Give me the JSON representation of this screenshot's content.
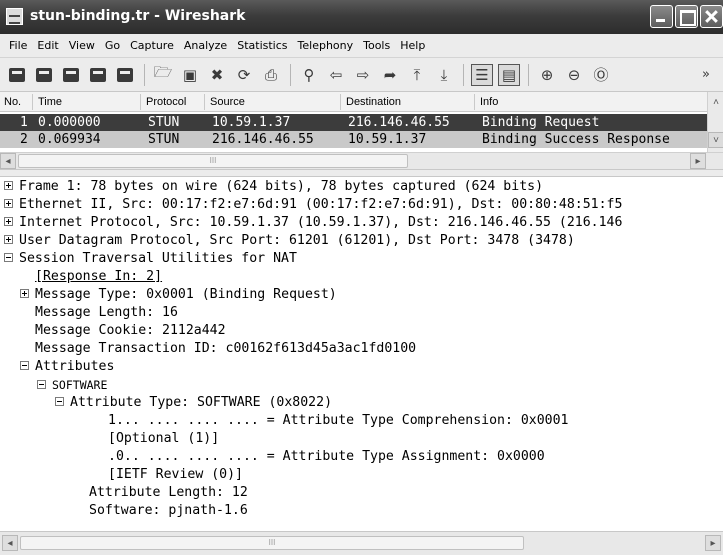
{
  "window": {
    "title": "stun-binding.tr - Wireshark"
  },
  "menu": [
    "File",
    "Edit",
    "View",
    "Go",
    "Capture",
    "Analyze",
    "Statistics",
    "Telephony",
    "Tools",
    "Help"
  ],
  "toolbar": {
    "overflow": "»"
  },
  "packet_list": {
    "columns": [
      "No.",
      "Time",
      "Protocol",
      "Source",
      "Destination",
      "Info"
    ],
    "rows": [
      {
        "no": "1",
        "time": "0.000000",
        "protocol": "STUN",
        "source": "10.59.1.37",
        "destination": "216.146.46.55",
        "info": "Binding Request"
      },
      {
        "no": "2",
        "time": "0.069934",
        "protocol": "STUN",
        "source": "216.146.46.55",
        "destination": "10.59.1.37",
        "info": "Binding Success Response"
      }
    ],
    "scroll_thumb": "III"
  },
  "details": {
    "lines": [
      "Frame 1: 78 bytes on wire (624 bits), 78 bytes captured (624 bits)",
      "Ethernet II, Src: 00:17:f2:e7:6d:91 (00:17:f2:e7:6d:91), Dst: 00:80:48:51:f5",
      "Internet Protocol, Src: 10.59.1.37 (10.59.1.37), Dst: 216.146.46.55 (216.146",
      "User Datagram Protocol, Src Port: 61201 (61201), Dst Port: 3478 (3478)",
      "Session Traversal Utilities for NAT",
      "[Response In: 2]",
      "Message Type: 0x0001 (Binding Request)",
      "Message Length: 16",
      "Message Cookie: 2112a442",
      "Message Transaction ID: c00162f613d45a3ac1fd0100",
      "Attributes",
      "SOFTWARE",
      "Attribute Type: SOFTWARE (0x8022)",
      "1... .... .... .... = Attribute Type Comprehension: 0x0001",
      "[Optional (1)]",
      ".0.. .... .... .... = Attribute Type Assignment: 0x0000",
      "[IETF Review (0)]",
      "Attribute Length: 12",
      "Software: pjnath-1.6"
    ]
  },
  "colors": {
    "titlebar": "#3c3c3c",
    "selected_row": "#3c3c3c",
    "other_row": "#c9c9c9"
  }
}
